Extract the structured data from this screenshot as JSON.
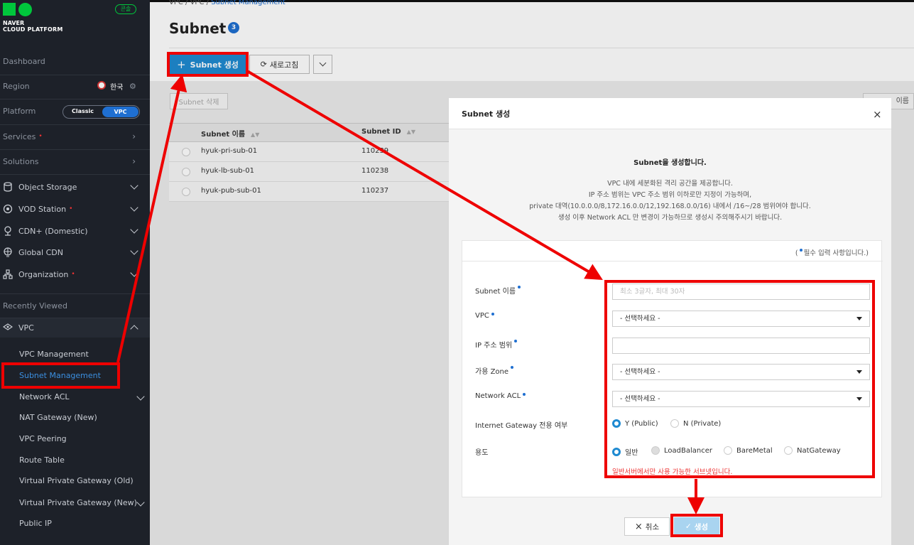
{
  "brand": {
    "line1": "NAVER",
    "line2": "CLOUD PLATFORM",
    "console_badge": "콘솔"
  },
  "sidebar": {
    "dashboard": "Dashboard",
    "region_label": "Region",
    "region_value": "한국",
    "platform_label": "Platform",
    "platform_options": {
      "classic": "Classic",
      "vpc": "VPC"
    },
    "services": "Services",
    "solutions": "Solutions",
    "products": [
      {
        "label": "Object Storage",
        "icon": "storage-icon",
        "new": false
      },
      {
        "label": "VOD Station",
        "icon": "vod-icon",
        "new": true
      },
      {
        "label": "CDN+ (Domestic)",
        "icon": "cdn-icon",
        "new": false
      },
      {
        "label": "Global CDN",
        "icon": "globe-icon",
        "new": false
      },
      {
        "label": "Organization",
        "icon": "organization-icon",
        "new": true
      }
    ],
    "recently_viewed": "Recently Viewed",
    "vpc_section": "VPC",
    "vpc_items": [
      "VPC Management",
      "Subnet Management",
      "Network ACL",
      "NAT Gateway (New)",
      "VPC Peering",
      "Route Table",
      "Virtual Private Gateway (Old)",
      "Virtual Private Gateway (New)",
      "Public IP"
    ]
  },
  "breadcrumb": {
    "a": "VPC",
    "b": "VPC",
    "c": "Subnet Management"
  },
  "page": {
    "title": "Subnet",
    "count": "3"
  },
  "toolbar": {
    "create": "Subnet 생성",
    "refresh": "새로고침",
    "delete": "Subnet 삭제",
    "right_fragment": "이름"
  },
  "table": {
    "headers": [
      "Subnet 이름",
      "Subnet ID"
    ],
    "rows": [
      {
        "name": "hyuk-pri-sub-01",
        "id": "110239"
      },
      {
        "name": "hyuk-lb-sub-01",
        "id": "110238"
      },
      {
        "name": "hyuk-pub-sub-01",
        "id": "110237"
      }
    ]
  },
  "modal": {
    "title": "Subnet 생성",
    "intro_title": "Subnet을 생성합니다.",
    "intro_lines": [
      "VPC 내에 세분화된 격리 공간을 제공합니다.",
      "IP 주소 범위는 VPC 주소 범위 이하로만 지정이 가능하며,",
      "private 대역(10.0.0.0/8,172.16.0.0/12,192.168.0.0/16) 내에서 /16~/28 범위여야 합니다.",
      "생성 이후 Network ACL 만 변경이 가능하므로 생성시 주의해주시기 바랍니다."
    ],
    "required_note_open": "(",
    "required_note": "필수 입력 사항입니다.)",
    "fields": {
      "name_label": "Subnet 이름",
      "name_placeholder": "최소 3글자, 최대 30자",
      "vpc_label": "VPC",
      "vpc_value": "- 선택하세요 -",
      "ip_label": "IP 주소 범위",
      "ip_value": "",
      "zone_label": "가용 Zone",
      "zone_value": "- 선택하세요 -",
      "acl_label": "Network ACL",
      "acl_value": "- 선택하세요 -",
      "igw_label": "Internet Gateway 전용 여부",
      "igw_options": [
        "Y (Public)",
        "N (Private)"
      ],
      "usage_label": "용도",
      "usage_options": [
        "일반",
        "LoadBalancer",
        "BareMetal",
        "NatGateway"
      ],
      "usage_note": "일반서버에서만 사용 가능한 서브넷입니다."
    },
    "cancel": "취소",
    "submit": "생성"
  },
  "colors": {
    "annotation": "#ee0000",
    "accent": "#1f8ad1",
    "sidebar_bg": "#1d2129"
  }
}
